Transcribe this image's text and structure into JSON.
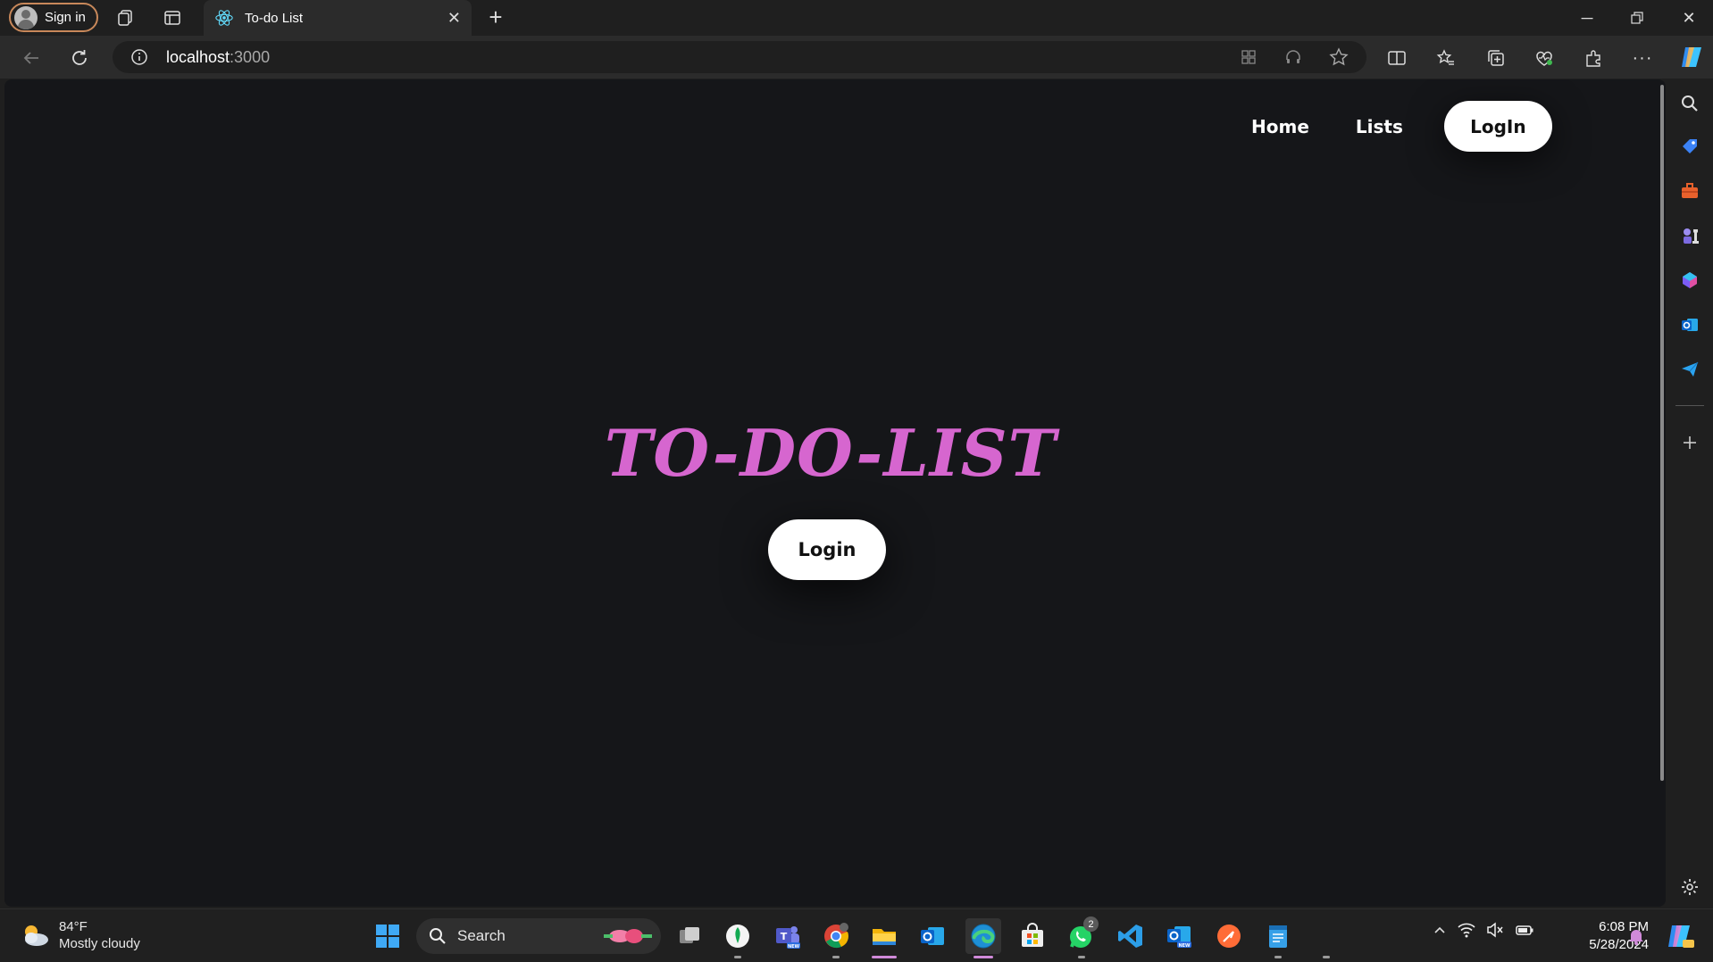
{
  "browser": {
    "profile_label": "Sign in",
    "tab_title": "To-do List",
    "url_host": "localhost",
    "url_port": ":3000"
  },
  "site": {
    "nav": {
      "home": "Home",
      "lists": "Lists",
      "login": "LogIn"
    },
    "hero": {
      "title": "TO-DO-LIST",
      "login_button": "Login"
    },
    "colors": {
      "background": "#151619",
      "title_accent": "#d666cf",
      "button_bg": "#ffffff"
    }
  },
  "taskbar": {
    "weather_temp": "84°F",
    "weather_desc": "Mostly cloudy",
    "search_label": "Search",
    "whatsapp_badge": "2",
    "time": "6:08 PM",
    "date": "5/28/2024"
  }
}
